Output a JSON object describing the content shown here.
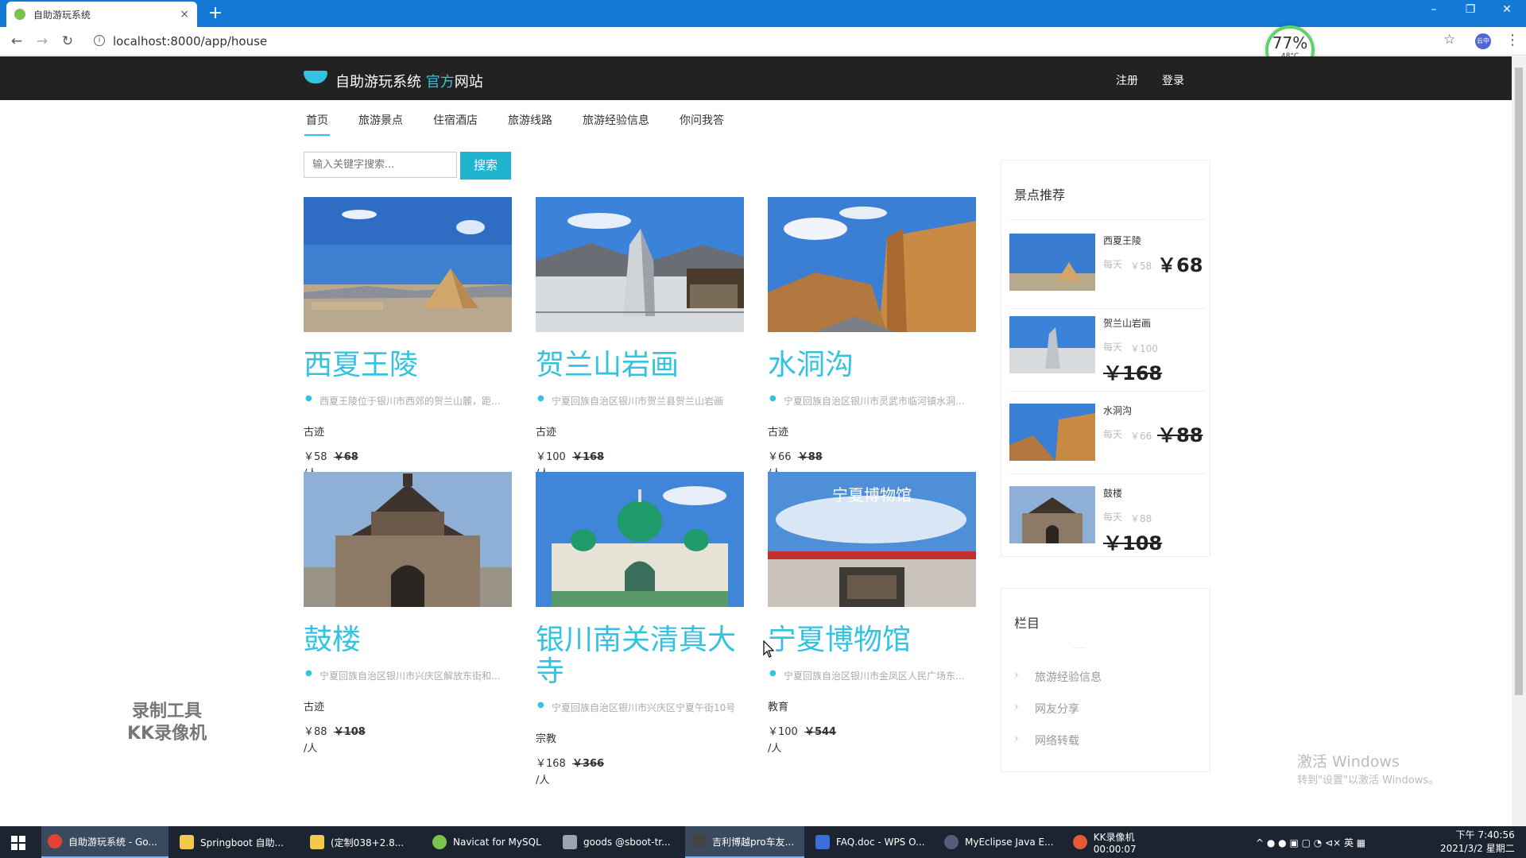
{
  "browser": {
    "tab_title": "自助游玩系统",
    "url": "localhost:8000/app/house",
    "new_tab": "+",
    "tab_close": "×",
    "win_min": "–",
    "win_max": "❐",
    "win_close": "✕",
    "profile_label": "云中",
    "cpu_percent": "77%",
    "cpu_temp": "48°C"
  },
  "site": {
    "brand_main": "自助游玩系统",
    "brand_accent": "官方",
    "brand_tail": "网站",
    "register": "注册",
    "login": "登录"
  },
  "nav": [
    "首页",
    "旅游景点",
    "住宿酒店",
    "旅游线路",
    "旅游经验信息",
    "你问我答"
  ],
  "search": {
    "placeholder": "输入关键字搜索...",
    "button": "搜索"
  },
  "cards": [
    {
      "name": "西夏王陵",
      "address": "西夏王陵位于银川市西郊的贺兰山麓，距...",
      "category": "古迹",
      "price": "￥58",
      "orig": "￥68",
      "unit": "/人"
    },
    {
      "name": "贺兰山岩画",
      "address": "宁夏回族自治区银川市贺兰县贺兰山岩画",
      "category": "古迹",
      "price": "￥100",
      "orig": "￥168",
      "unit": "/人"
    },
    {
      "name": "水洞沟",
      "address": "宁夏回族自治区银川市灵武市临河镇水洞...",
      "category": "古迹",
      "price": "￥66",
      "orig": "￥88",
      "unit": "/人"
    },
    {
      "name": "鼓楼",
      "address": "宁夏回族自治区银川市兴庆区解放东街和...",
      "category": "古迹",
      "price": "￥88",
      "orig": "￥108",
      "unit": "/人"
    },
    {
      "name": "银川南关清真大寺",
      "address": "宁夏回族自治区银川市兴庆区宁夏午街10号",
      "category": "宗教",
      "price": "￥168",
      "orig": "￥366",
      "unit": "/人"
    },
    {
      "name": "宁夏博物馆",
      "address": "宁夏回族自治区银川市金凤区人民广场东...",
      "category": "教育",
      "price": "￥100",
      "orig": "￥544",
      "unit": "/人"
    }
  ],
  "museum_sign": "宁夏博物馆",
  "sidebar": {
    "title": "景点推荐",
    "items": [
      {
        "name": "西夏王陵",
        "label": "每天",
        "price": "￥58",
        "big": "￥68"
      },
      {
        "name": "贺兰山岩画",
        "label": "每天",
        "price": "￥100",
        "big": "￥168"
      },
      {
        "name": "水洞沟",
        "label": "每天",
        "price": "￥66",
        "big": "￥88"
      },
      {
        "name": "鼓楼",
        "label": "每天",
        "price": "￥88",
        "big": "￥108"
      }
    ],
    "columns_title": "栏目",
    "columns": [
      "旅游经验信息",
      "网友分享",
      "网络转载"
    ]
  },
  "watermark": {
    "line1": "激活 Windows",
    "line2": "转到\"设置\"以激活 Windows。"
  },
  "recorder": {
    "line1": "录制工具",
    "line2": "KK录像机"
  },
  "taskbar": {
    "items": [
      {
        "label": "自助游玩系统 - Go...",
        "color": "#e34133"
      },
      {
        "label": "Springboot 自助...",
        "color": "#f2c94c"
      },
      {
        "label": "(定制038+2.8...",
        "color": "#f2c94c"
      },
      {
        "label": "Navicat for MySQL",
        "color": "#7cc24f"
      },
      {
        "label": "goods @sboot-tr...",
        "color": "#9aa4b2"
      },
      {
        "label": "吉利博越pro车友...",
        "color": "#444"
      },
      {
        "label": "FAQ.doc - WPS O...",
        "color": "#3a6fd8"
      },
      {
        "label": "MyEclipse Java E...",
        "color": "#5a5a7a"
      },
      {
        "label": "KK录像机 00:00:07",
        "color": "#e35b33"
      }
    ],
    "tray": "^  ●  ●  ▣  ▢  ◔  ⊲×  英  ▦",
    "time": "下午 7:40:56",
    "date": "2021/3/2 星期二"
  }
}
